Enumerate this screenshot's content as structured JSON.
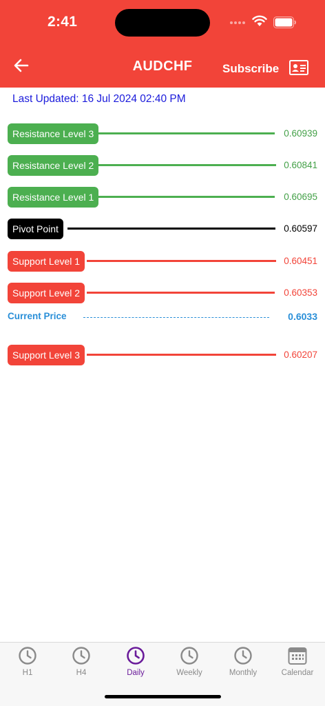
{
  "status_bar": {
    "time": "2:41"
  },
  "header": {
    "title": "AUDCHF",
    "subscribe_label": "Subscribe"
  },
  "last_updated": "Last Updated: 16 Jul 2024 02:40 PM",
  "levels": [
    {
      "label": "Resistance Level 3",
      "value": "0.60939"
    },
    {
      "label": "Resistance Level 2",
      "value": "0.60841"
    },
    {
      "label": "Resistance Level 1",
      "value": "0.60695"
    },
    {
      "label": "Pivot Point",
      "value": "0.60597"
    },
    {
      "label": "Support Level 1",
      "value": "0.60451"
    },
    {
      "label": "Support Level 2",
      "value": "0.60353"
    },
    {
      "label": "Support Level 3",
      "value": "0.60207"
    }
  ],
  "current_price": {
    "label": "Current Price",
    "value": "0.6033"
  },
  "tabs": [
    {
      "label": "H1",
      "icon": "clock-icon"
    },
    {
      "label": "H4",
      "icon": "clock-icon"
    },
    {
      "label": "Daily",
      "icon": "clock-icon",
      "active": true
    },
    {
      "label": "Weekly",
      "icon": "clock-icon"
    },
    {
      "label": "Monthly",
      "icon": "clock-icon"
    },
    {
      "label": "Calendar",
      "icon": "calendar-icon"
    }
  ],
  "colors": {
    "header": "#f24439",
    "resistance": "#4caf50",
    "pivot": "#000000",
    "support": "#f24439",
    "current_price": "#2a8fd8",
    "active_tab": "#6a1b9a",
    "last_updated": "#1a1adb"
  }
}
